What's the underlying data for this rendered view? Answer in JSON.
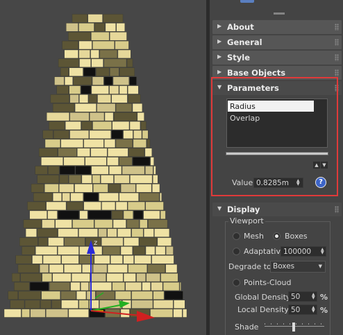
{
  "rollouts": {
    "about": "About",
    "general": "General",
    "style": "Style",
    "base_objects": "Base Objects",
    "parameters": "Parameters",
    "display": "Display"
  },
  "parameters": {
    "list_items": [
      "Radius",
      "Overlap"
    ],
    "selected_item": "Radius",
    "value_label": "Value",
    "value": "0.8285m",
    "help_symbol": "?"
  },
  "display": {
    "viewport_group": "Viewport",
    "mesh_label": "Mesh",
    "boxes_label": "Boxes",
    "adaptative_label": "Adaptative",
    "adaptative_value": "100000",
    "degrade_to_label": "Degrade to",
    "degrade_to_value": "Boxes",
    "points_cloud_label": "Points-Cloud",
    "global_density_label": "Global Density",
    "global_density_value": "50",
    "local_density_label": "Local Density",
    "local_density_value": "50",
    "percent": "%",
    "shade_label": "Shade"
  },
  "gizmo": {
    "z_axis": "z"
  },
  "colors": {
    "highlight": "#e03a3a",
    "panel_bg": "#444444",
    "header_bg": "#565656",
    "brick_light": "#efe2a4",
    "brick_mid": "#d8cc8a",
    "brick_dark": "#5c5535"
  },
  "icons": [
    "expand-arrow-icon",
    "collapse-arrow-icon",
    "grip-icon",
    "help-icon",
    "up-arrow-icon",
    "down-arrow-icon",
    "dropdown-arrow-icon",
    "axis-gizmo-icon"
  ]
}
